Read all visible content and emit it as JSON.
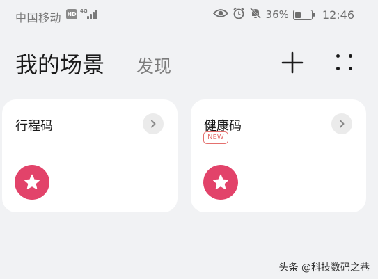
{
  "status_bar": {
    "carrier": "中国移动",
    "hd": "HD",
    "network": "4G",
    "battery_percent": "36%",
    "battery_level": 0.36,
    "time": "12:46",
    "icons": [
      "eye-icon",
      "alarm-icon",
      "mute-bell-icon"
    ]
  },
  "header": {
    "title": "我的场景",
    "discover_tab": "发现",
    "add_icon": "plus-icon",
    "more_icon": "grid-dots-icon"
  },
  "cards": [
    {
      "title": "行程码",
      "badge": "",
      "arrow_icon": "chevron-right-icon",
      "action_icon": "star-icon"
    },
    {
      "title": "健康码",
      "badge": "NEW",
      "arrow_icon": "chevron-right-icon",
      "action_icon": "star-icon"
    }
  ],
  "colors": {
    "background": "#f1f2f4",
    "card": "#ffffff",
    "accent": "#e2436a",
    "badge": "#e4706e"
  },
  "watermark": "头条 @科技数码之巷"
}
